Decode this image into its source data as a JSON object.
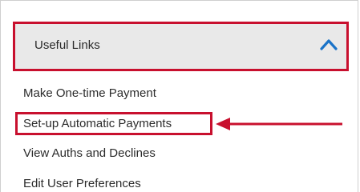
{
  "panel": {
    "title": "Useful Links",
    "links": [
      {
        "label": "Make One-time Payment"
      },
      {
        "label": "Set-up Automatic Payments"
      },
      {
        "label": "View Auths and Declines"
      },
      {
        "label": "Edit User Preferences"
      }
    ]
  },
  "colors": {
    "highlight": "#c8102e",
    "chevron": "#1a73c8",
    "header_bg": "#e9e9e9",
    "text": "#2b2b2b"
  },
  "icons": {
    "collapse": "chevron-up-icon",
    "annotation": "arrow-left-icon"
  }
}
